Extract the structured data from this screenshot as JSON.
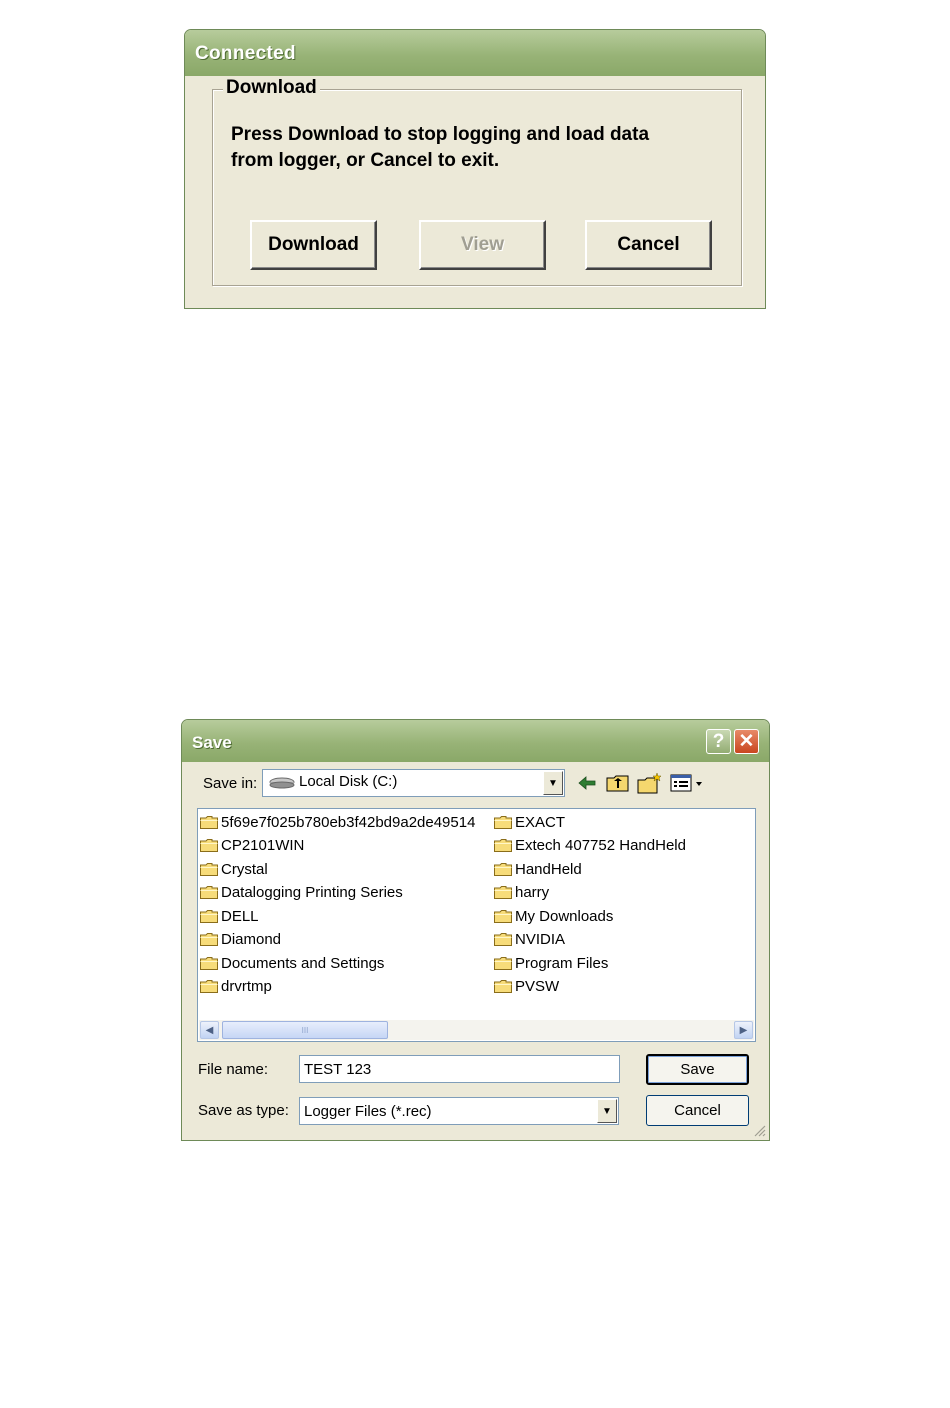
{
  "connected_dialog": {
    "title": "Connected",
    "group_label": "Download",
    "message_line1": "Press Download to stop logging and load data",
    "message_line2": "from logger, or Cancel to exit.",
    "buttons": {
      "download": "Download",
      "view": "View",
      "cancel": "Cancel"
    }
  },
  "save_dialog": {
    "title": "Save",
    "help_glyph": "?",
    "close_glyph": "✕",
    "save_in_label": "Save in:",
    "save_in_value": "Local Disk (C:)",
    "folders_left": [
      "5f69e7f025b780eb3f42bd9a2de49514",
      "CP2101WIN",
      "Crystal",
      "Datalogging Printing Series",
      "DELL",
      "Diamond",
      "Documents and Settings",
      "drvrtmp"
    ],
    "folders_right": [
      "EXACT",
      "Extech 407752 HandHeld",
      "HandHeld",
      "harry",
      "My Downloads",
      "NVIDIA",
      "Program Files",
      "PVSW"
    ],
    "file_name_label": "File name:",
    "file_name_value": "TEST 123",
    "save_as_type_label": "Save as type:",
    "save_as_type_value": "Logger Files (*.rec)",
    "buttons": {
      "save": "Save",
      "cancel": "Cancel"
    },
    "scroll_thumb_grip": "III",
    "icons": [
      "drive-icon",
      "back-icon",
      "up-folder-icon",
      "new-folder-icon",
      "view-menu-icon",
      "folder-icon"
    ]
  }
}
